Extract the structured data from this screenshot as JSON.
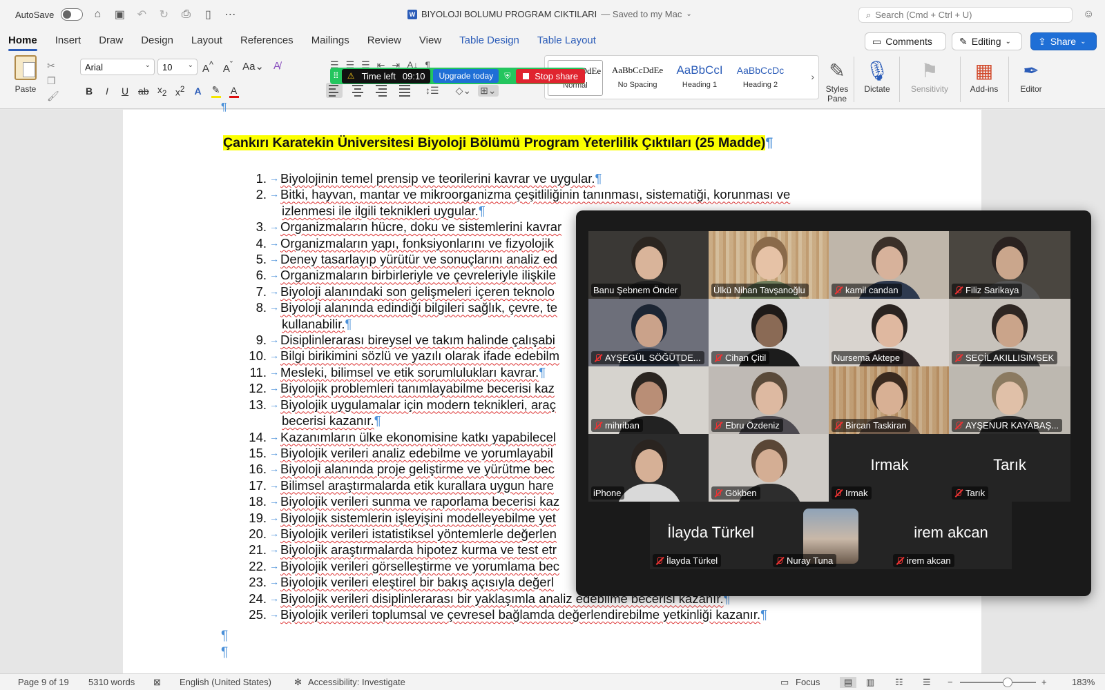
{
  "titlebar": {
    "autosave_label": "AutoSave",
    "doc_title": "BIYOLOJI BOLUMU PROGRAM CIKTILARI",
    "saved_status": "— Saved to my Mac",
    "search_placeholder": "Search (Cmd + Ctrl + U)"
  },
  "ribbon_tabs": [
    "Home",
    "Insert",
    "Draw",
    "Design",
    "Layout",
    "References",
    "Mailings",
    "Review",
    "View",
    "Table Design",
    "Table Layout"
  ],
  "ribbon_buttons": {
    "comments": "Comments",
    "editing": "Editing",
    "share": "Share"
  },
  "home_ribbon": {
    "paste_label": "Paste",
    "font_name": "Arial",
    "font_size": "10",
    "styles": [
      {
        "preview": "AaBbCcDdEe",
        "label": "Normal"
      },
      {
        "preview": "AaBbCcDdEe",
        "label": "No Spacing"
      },
      {
        "preview": "AaBbCcI",
        "label": "Heading 1"
      },
      {
        "preview": "AaBbCcDc",
        "label": "Heading 2"
      }
    ],
    "styles_pane_label": "Styles Pane",
    "dictate_label": "Dictate",
    "sensitivity_label": "Sensitivity",
    "addins_label": "Add-ins",
    "editor_label": "Editor"
  },
  "zoom_share_bar": {
    "time_left_label": "Time left",
    "time_left_value": "09:10",
    "upgrade_label": "Upgrade today",
    "stop_share_label": "Stop share"
  },
  "document": {
    "title": "Çankırı Karatekin Üniversitesi Biyoloji Bölümü Program Yeterlilik Çıktıları (25 Madde)",
    "items": [
      {
        "n": "1.",
        "text": "Biyolojinin temel prensip ve teorilerini kavrar ve uygular."
      },
      {
        "n": "2.",
        "text": "Bitki, hayvan, mantar ve mikroorganizma çeşitliliğinin tanınması, sistematiği, korunması ve",
        "cont": "izlenmesi ile ilgili teknikleri uygular."
      },
      {
        "n": "3.",
        "text": "Organizmaların hücre, doku ve sistemlerini kavrar"
      },
      {
        "n": "4.",
        "text": "Organizmaların yapı, fonksiyonlarını ve fizyolojik"
      },
      {
        "n": "5.",
        "text": "Deney tasarlayıp yürütür ve sonuçlarını analiz ed"
      },
      {
        "n": "6.",
        "text": "Organizmaların birbirleriyle ve çevreleriyle ilişkile"
      },
      {
        "n": "7.",
        "text": "Biyoloji alanındaki son gelişmeleri içeren teknolo"
      },
      {
        "n": "8.",
        "text": "Biyoloji alanında edindiği bilgileri sağlık, çevre, te",
        "cont": "kullanabilir."
      },
      {
        "n": "9.",
        "text": "Disiplinlerarası bireysel ve takım halinde çalışabi"
      },
      {
        "n": "10.",
        "text": "Bilgi birikimini sözlü ve yazılı olarak ifade edebilm"
      },
      {
        "n": "11.",
        "text": "Mesleki, bilimsel ve etik sorumlulukları kavrar."
      },
      {
        "n": "12.",
        "text": "Biyolojik problemleri tanımlayabilme becerisi kaz"
      },
      {
        "n": "13.",
        "text": "Biyolojik uygulamalar için modern teknikleri, araç",
        "cont": "becerisi kazanır."
      },
      {
        "n": "14.",
        "text": "Kazanımların ülke ekonomisine katkı yapabilecel"
      },
      {
        "n": "15.",
        "text": "Biyolojik verileri analiz edebilme ve yorumlayabil"
      },
      {
        "n": "16.",
        "text": "Biyoloji alanında proje geliştirme ve yürütme bec"
      },
      {
        "n": "17.",
        "text": "Bilimsel araştırmalarda etik kurallara uygun hare"
      },
      {
        "n": "18.",
        "text": "Biyolojik verileri sunma ve raporlama becerisi kaz"
      },
      {
        "n": "19.",
        "text": "Biyolojik sistemlerin işleyişini modelleyebilme yet"
      },
      {
        "n": "20.",
        "text": "Biyolojik verileri istatistiksel yöntemlerle değerlen"
      },
      {
        "n": "21.",
        "text": "Biyolojik araştırmalarda hipotez kurma ve test etr"
      },
      {
        "n": "22.",
        "text": "Biyolojik verileri görselleştirme ve yorumlama bec"
      },
      {
        "n": "23.",
        "text": "Biyolojik verileri eleştirel bir bakış açısıyla değerl"
      },
      {
        "n": "24.",
        "text": "Biyolojik verileri disiplinlerarası bir yaklaşımla analiz edebilme becerisi kazanır."
      },
      {
        "n": "25.",
        "text": "Biyolojik verileri toplumsal ve çevresel bağlamda değerlendirebilme yetkinliği kazanır."
      }
    ]
  },
  "statusbar": {
    "page": "Page 9 of 19",
    "words": "5310 words",
    "language": "English (United States)",
    "accessibility": "Accessibility: Investigate",
    "focus": "Focus",
    "zoom": "183%"
  },
  "zoom_gallery": {
    "participants": [
      {
        "name": "Banu Şebnem Önder",
        "muted": false
      },
      {
        "name": "Ülkü Nihan Tavşanoğlu",
        "muted": false
      },
      {
        "name": "kamil candan",
        "muted": true
      },
      {
        "name": "Filiz Sarikaya",
        "muted": true
      },
      {
        "name": "AYŞEGÜL SÖĞÜTDE...",
        "muted": true
      },
      {
        "name": "Cihan Çitil",
        "muted": true
      },
      {
        "name": "Nursema Aktepe",
        "muted": false,
        "speaking": true
      },
      {
        "name": "SECİL AKILLISIMSEK",
        "muted": true
      },
      {
        "name": "mihriban",
        "muted": true
      },
      {
        "name": "Ebru Özdeniz",
        "muted": true
      },
      {
        "name": "Bircan Taskiran",
        "muted": true
      },
      {
        "name": "AYŞENUR KAYABAŞ...",
        "muted": true
      },
      {
        "name": "iPhone",
        "muted": false
      },
      {
        "name": "Gökben",
        "muted": true
      },
      {
        "name": "Irmak",
        "muted": true,
        "video_off_name": "Irmak"
      },
      {
        "name": "Tarık",
        "muted": true,
        "video_off_name": "Tarık"
      },
      {
        "name": "İlayda Türkel",
        "muted": true,
        "video_off_name": "İlayda Türkel"
      },
      {
        "name": "Nuray Tuna",
        "muted": true
      },
      {
        "name": "irem akcan",
        "muted": true,
        "video_off_name": "irem akcan"
      }
    ]
  },
  "colors": {
    "accent_blue": "#2b5cb8",
    "share_blue": "#1f6fd6",
    "stop_red": "#e0242f",
    "zoom_green": "#23c55e",
    "highlight_yellow": "#fbff00",
    "pilcrow_blue": "#4a90d9",
    "mute_red": "#e33333"
  }
}
